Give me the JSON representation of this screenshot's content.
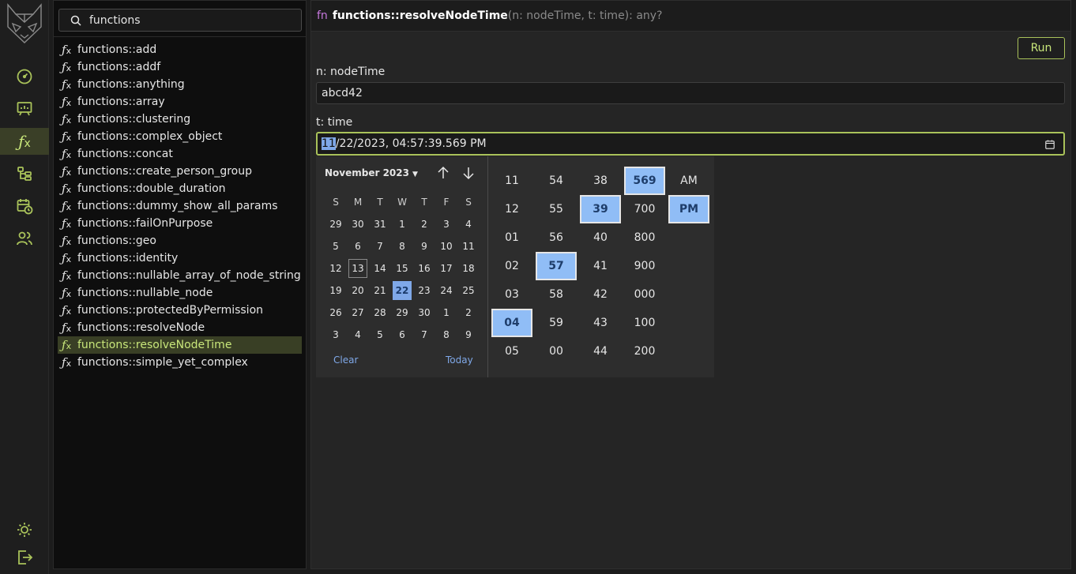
{
  "search": {
    "value": "functions"
  },
  "functions": [
    "functions::add",
    "functions::addf",
    "functions::anything",
    "functions::array",
    "functions::clustering",
    "functions::complex_object",
    "functions::concat",
    "functions::create_person_group",
    "functions::double_duration",
    "functions::dummy_show_all_params",
    "functions::failOnPurpose",
    "functions::geo",
    "functions::identity",
    "functions::nullable_array_of_node_string",
    "functions::nullable_node",
    "functions::protectedByPermission",
    "functions::resolveNode",
    "functions::resolveNodeTime",
    "functions::simple_yet_complex"
  ],
  "selected_function": "functions::resolveNodeTime",
  "header": {
    "keyword": "fn",
    "name": "functions::resolveNodeTime",
    "signature": "(n: nodeTime, t: time): any?"
  },
  "run_label": "Run",
  "params": {
    "n": {
      "label": "n: nodeTime",
      "value": "abcd42"
    },
    "t": {
      "label": "t: time",
      "value_highlight": "11",
      "value_rest": "/22/2023, 04:57:39.569 PM"
    }
  },
  "calendar": {
    "month_label": "November 2023",
    "weekdays": [
      "S",
      "M",
      "T",
      "W",
      "T",
      "F",
      "S"
    ],
    "weeks": [
      [
        "29",
        "30",
        "31",
        "1",
        "2",
        "3",
        "4"
      ],
      [
        "5",
        "6",
        "7",
        "8",
        "9",
        "10",
        "11"
      ],
      [
        "12",
        "13",
        "14",
        "15",
        "16",
        "17",
        "18"
      ],
      [
        "19",
        "20",
        "21",
        "22",
        "23",
        "24",
        "25"
      ],
      [
        "26",
        "27",
        "28",
        "29",
        "30",
        "1",
        "2"
      ],
      [
        "3",
        "4",
        "5",
        "6",
        "7",
        "8",
        "9"
      ]
    ],
    "today": "13",
    "selected": "22",
    "clear_label": "Clear",
    "today_label": "Today"
  },
  "time_columns": {
    "hours": [
      "11",
      "12",
      "01",
      "02",
      "03",
      "04",
      "05"
    ],
    "minutes": [
      "54",
      "55",
      "56",
      "57",
      "58",
      "59",
      "00"
    ],
    "seconds": [
      "38",
      "39",
      "40",
      "41",
      "42",
      "43",
      "44"
    ],
    "milliseconds": [
      "569",
      "700",
      "800",
      "900",
      "000",
      "100",
      "200"
    ],
    "ampm": [
      "AM",
      "PM"
    ],
    "selected": {
      "hours": "04",
      "minutes": "57",
      "seconds": "39",
      "milliseconds": "569",
      "ampm": "PM"
    }
  },
  "colors": {
    "accent": "#a9c25a",
    "selection_blue": "#7fa8e8"
  }
}
